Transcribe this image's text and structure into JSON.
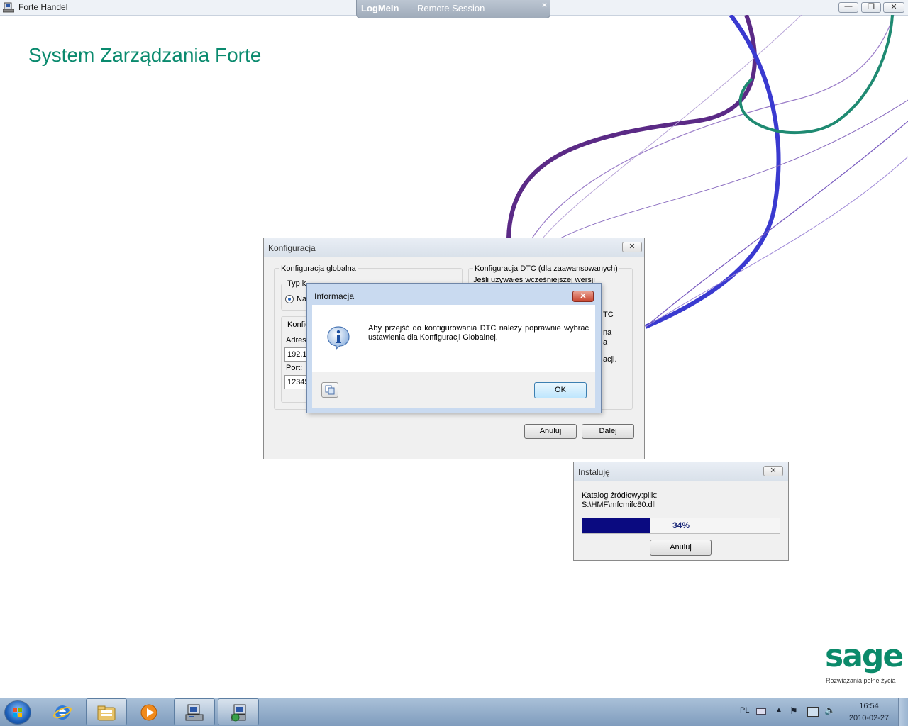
{
  "app": {
    "title": "Forte Handel"
  },
  "logmein": {
    "brand": "LogMeIn",
    "separator": " - ",
    "session": "Remote Session",
    "close": "×"
  },
  "window_controls": {
    "minimize": "—",
    "restore": "❐",
    "close": "✕"
  },
  "heading": "System Zarządzania Forte",
  "konfiguracja": {
    "title": "Konfiguracja",
    "close": "✕",
    "global_group": "Konfiguracja globalna",
    "typ_group": "Typ k",
    "radio_label": "Na",
    "konfig_group": "Konfig",
    "adres_label": "Adres",
    "adres_value": "192.1",
    "port_label": "Port:",
    "port_value": "12345",
    "dtc_group": "Konfiguracja DTC (dla zaawansowanych)",
    "dtc_line1": "Jeśli używałeś wcześniejszej wersji",
    "dtc_frag1": "TC",
    "dtc_frag2": "na",
    "dtc_frag3": "a",
    "dtc_frag4": "acji.",
    "anuluj": "Anuluj",
    "dalej": "Dalej"
  },
  "informacja": {
    "title": "Informacja",
    "close": "✕",
    "message": "Aby przejść do konfigurowania DTC należy poprawnie wybrać ustawienia dla Konfiguracji Globalnej.",
    "ok": "OK"
  },
  "instaluje": {
    "title": "Instaluję",
    "close": "✕",
    "line1": "Katalog źródłowy:plik:",
    "line2": "S:\\HMF\\mfcmifc80.dll",
    "progress_percent": 34,
    "progress_label": "34%",
    "anuluj": "Anuluj"
  },
  "sage": {
    "logo": "sage",
    "tagline": "Rozwiązania pełne życia"
  },
  "taskbar": {
    "items": [
      "start-button",
      "internet-explorer-icon",
      "windows-explorer-icon",
      "media-player-icon",
      "forte-installer-icon",
      "forte-setup-icon"
    ],
    "language": "PL",
    "time": "16:54",
    "date": "2010-02-27"
  },
  "colors": {
    "heading": "#0a8a6e",
    "swoosh_purple": "#5b2a86",
    "swoosh_blue": "#3a3ad0",
    "swoosh_teal": "#1f8a72",
    "progress_fill": "#0a0a80"
  }
}
